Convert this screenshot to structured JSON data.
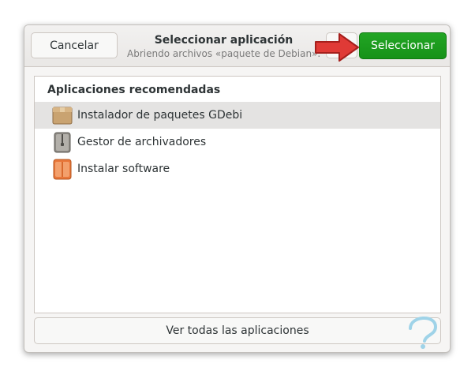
{
  "header": {
    "cancel_label": "Cancelar",
    "title": "Seleccionar aplicación",
    "subtitle": "Abriendo archivos «paquete de Debian».",
    "select_label": "Seleccionar",
    "search_icon": "search-icon"
  },
  "list": {
    "section_title": "Aplicaciones recomendadas",
    "items": [
      {
        "label": "Instalador de paquetes GDebi",
        "icon": "package-box-icon",
        "selected": true
      },
      {
        "label": "Gestor de archivadores",
        "icon": "archive-manager-icon",
        "selected": false
      },
      {
        "label": "Instalar software",
        "icon": "software-install-icon",
        "selected": false
      }
    ]
  },
  "footer": {
    "view_all_label": "Ver todas las aplicaciones"
  },
  "colors": {
    "accent_green": "#169218",
    "selected_row": "#e4e3e2",
    "arrow_red": "#e03a36"
  }
}
